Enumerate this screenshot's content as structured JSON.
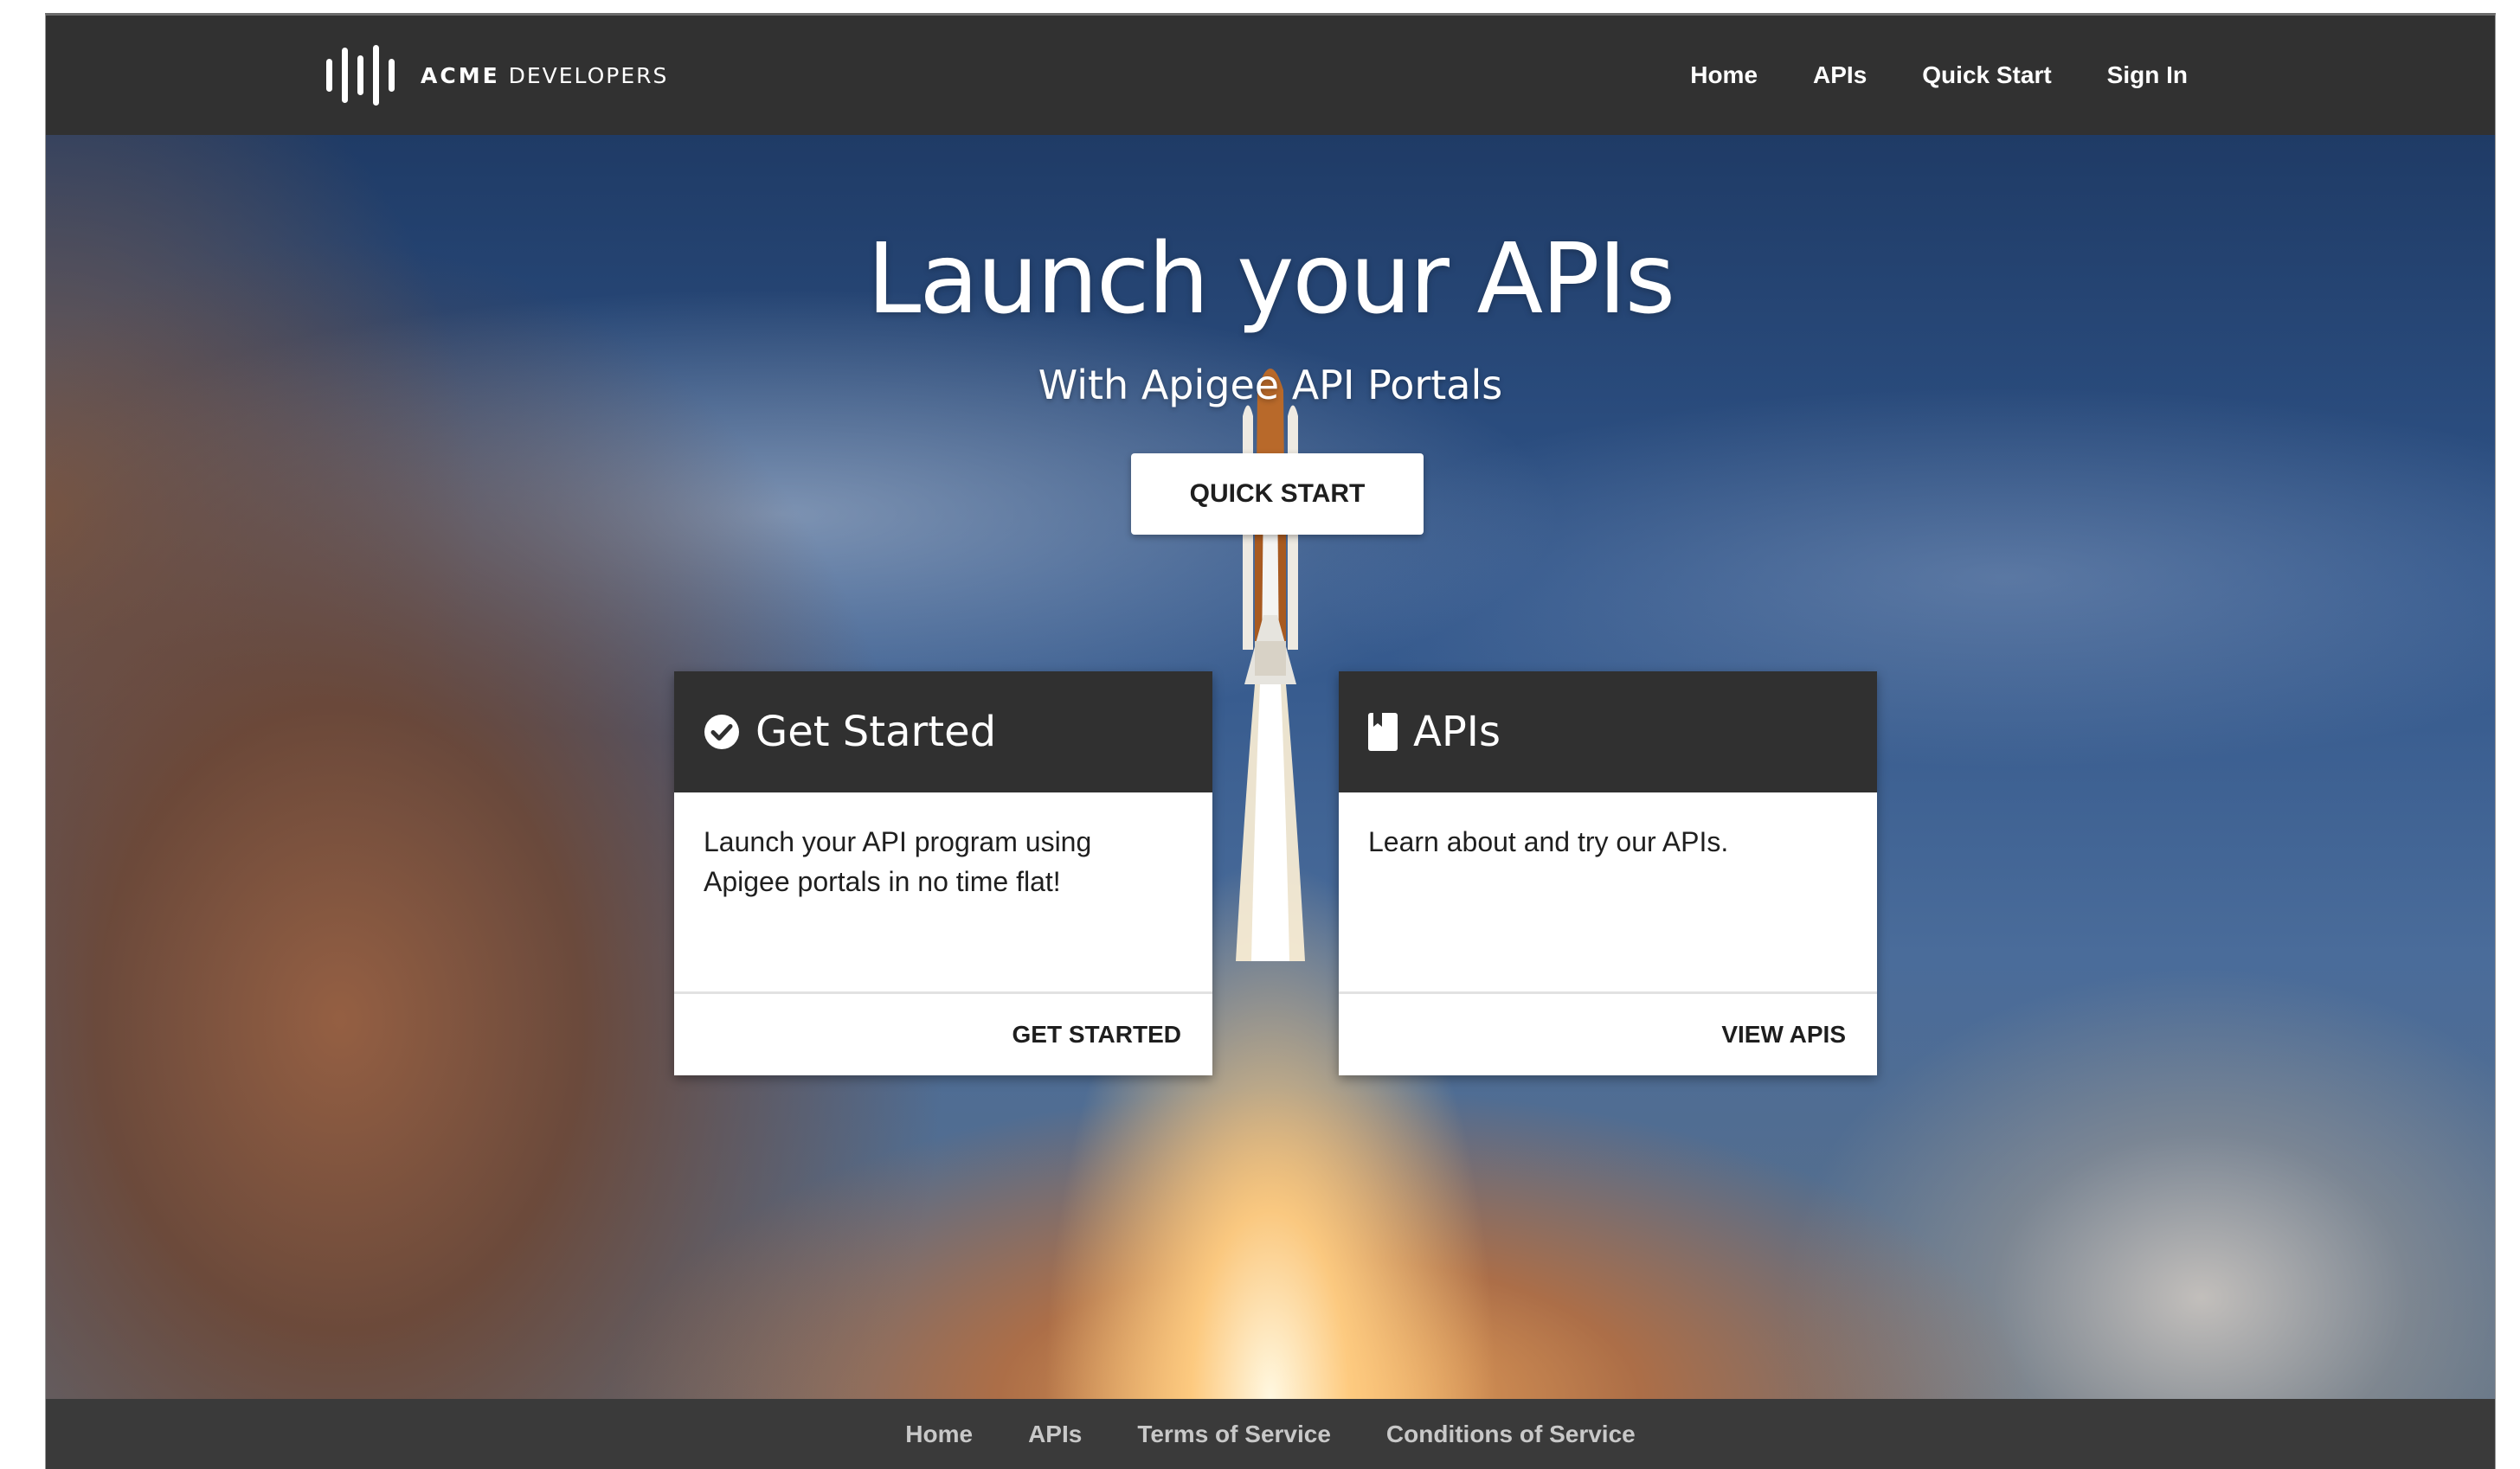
{
  "header": {
    "logo_text": {
      "brand": "ACME",
      "suffix": "DEVELOPERS"
    },
    "nav": [
      {
        "label": "Home"
      },
      {
        "label": "APIs"
      },
      {
        "label": "Quick Start"
      },
      {
        "label": "Sign In"
      }
    ]
  },
  "hero": {
    "title": "Launch your APIs",
    "subtitle": "With Apigee API Portals",
    "cta_label": "QUICK START"
  },
  "cards": [
    {
      "icon": "check-circle-icon",
      "title": "Get Started",
      "body": "Launch your API program using Apigee portals in no time flat!",
      "action": "GET STARTED"
    },
    {
      "icon": "book-icon",
      "title": "APIs",
      "body": "Learn about and try our APIs.",
      "action": "VIEW APIS"
    }
  ],
  "footer": {
    "links": [
      {
        "label": "Home"
      },
      {
        "label": "APIs"
      },
      {
        "label": "Terms of Service"
      },
      {
        "label": "Conditions of Service"
      }
    ]
  },
  "colors": {
    "header_bg": "#313131",
    "card_header_bg": "#303030",
    "footer_bg": "#3a3a3a",
    "footer_text": "#c8c8c8"
  }
}
